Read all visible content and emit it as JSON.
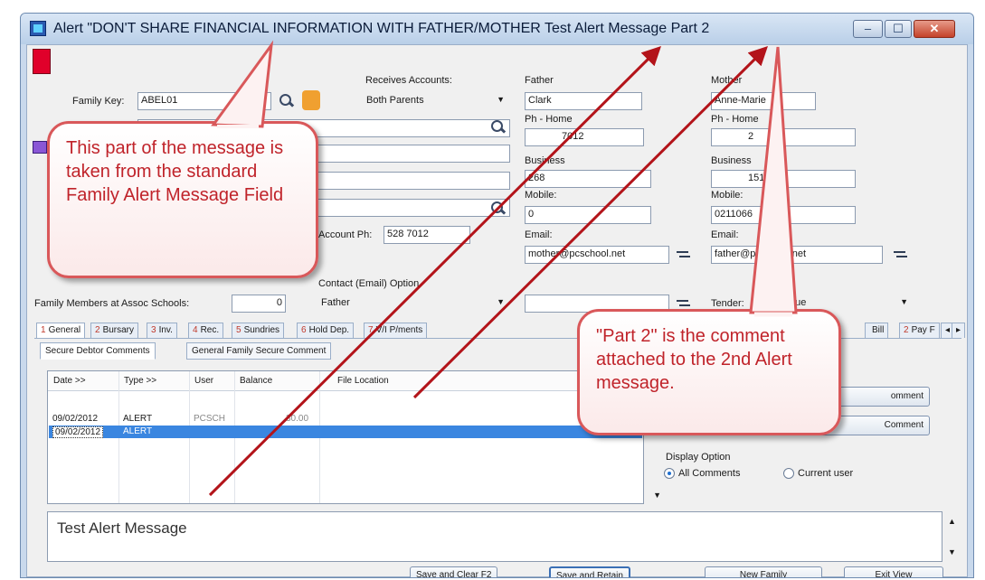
{
  "window": {
    "title": "Alert \"DON'T SHARE FINANCIAL INFORMATION WITH FATHER/MOTHER Test Alert Message Part 2",
    "controls": {
      "minimize": "–",
      "maximize": "☐",
      "close": "✕"
    }
  },
  "family": {
    "family_key_label": "Family Key:",
    "family_key_value": "ABEL01",
    "receives_accounts_label": "Receives Accounts:",
    "receives_accounts_value": "Both Parents",
    "account_ph_label": "Account Ph:",
    "account_ph_value": "528 7012",
    "contact_option_label": "Contact (Email) Option",
    "contact_option_value": "Father",
    "members_label": "Family Members at Assoc Schools:",
    "members_value": "0"
  },
  "father": {
    "heading": "Father",
    "name": "Clark",
    "ph_home_label": "Ph - Home",
    "ph_home_value": "7012",
    "business_label": "Business",
    "business_value": "268",
    "mobile_label": "Mobile:",
    "mobile_value": "0",
    "email_label": "Email:",
    "email_value": "mother@pcschool.net"
  },
  "mother": {
    "heading": "Mother",
    "name": "Anne-Marie",
    "ph_home_label": "Ph - Home",
    "ph_home_value": "2",
    "business_label": "Business",
    "business_value": "151",
    "mobile_label": "Mobile:",
    "mobile_value": "0211066",
    "email_label": "Email:",
    "email_value": "father@pcschool.net",
    "tender_label": "Tender:",
    "tender_value": "que"
  },
  "tabs": [
    {
      "num": "1",
      "label": "General"
    },
    {
      "num": "2",
      "label": "Bursary"
    },
    {
      "num": "3",
      "label": "Inv."
    },
    {
      "num": "4",
      "label": "Rec."
    },
    {
      "num": "5",
      "label": "Sundries"
    },
    {
      "num": "6",
      "label": "Hold Dep."
    },
    {
      "num": "7",
      "label": "V/I P/ments"
    },
    {
      "num": "",
      "label": "Bill"
    },
    {
      "num": "2",
      "label": "Pay F"
    }
  ],
  "subtabs": {
    "secure": "Secure Debtor Comments",
    "general": "General Family Secure Comment"
  },
  "grid": {
    "headers": [
      "Date >>",
      "Type >>",
      "User",
      "Balance",
      "File Location"
    ],
    "rows": [
      {
        "date": "09/02/2012",
        "type": "ALERT",
        "user": "PCSCH",
        "balance": "30.00",
        "location": ""
      },
      {
        "date": "09/02/2012",
        "type": "ALERT",
        "user": "",
        "balance": "",
        "location": ""
      }
    ]
  },
  "comment_buttons": {
    "add": "omment",
    "edit": "Comment"
  },
  "display_option": {
    "label": "Display Option",
    "all": "All Comments",
    "current": "Current user"
  },
  "comment_text": "Test Alert Message",
  "bottom_buttons": {
    "save_clear": "Save and Clear  F2",
    "save_retain": "Save and Retain",
    "new_family": "New Family",
    "exit_view": "Exit View"
  },
  "annotations": {
    "callout_left": "This part of the message is taken from the standard Family Alert Message Field",
    "callout_right": "\"Part 2\" is the comment attached to the 2nd Alert message."
  },
  "colors": {
    "callout_border": "#d9585a",
    "callout_text": "#c0232a",
    "arrow": "#b3141a",
    "selection": "#3a86e0"
  }
}
